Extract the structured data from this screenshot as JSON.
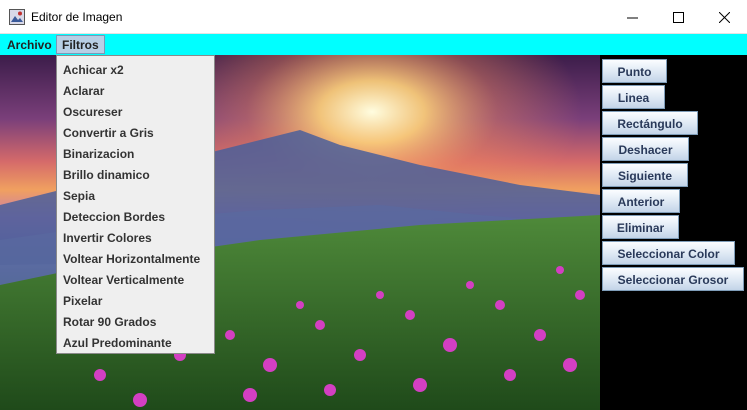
{
  "window": {
    "title": "Editor de Imagen",
    "icon": "app-icon",
    "controls": [
      "minimize-icon",
      "maximize-icon",
      "close-icon"
    ]
  },
  "menubar": {
    "color": "#00ffff",
    "items": [
      {
        "label": "Archivo"
      },
      {
        "label": "Filtros",
        "active": true
      }
    ]
  },
  "filters_menu": {
    "items": [
      "Achicar x2",
      "Aclarar",
      "Oscureser",
      "Convertir a Gris",
      "Binarizacion",
      "Brillo dinamico",
      "Sepia",
      "Deteccion Bordes",
      "Invertir Colores",
      "Voltear Horizontalmente",
      "Voltear Verticalmente",
      "Pixelar",
      "Rotar 90 Grados",
      "Azul Predominante"
    ]
  },
  "tools": {
    "buttons": [
      "Punto",
      "Linea",
      "Rectángulo",
      "Deshacer",
      "Siguiente",
      "Anterior",
      "Eliminar",
      "Seleccionar Color",
      "Seleccionar Grosor"
    ]
  }
}
